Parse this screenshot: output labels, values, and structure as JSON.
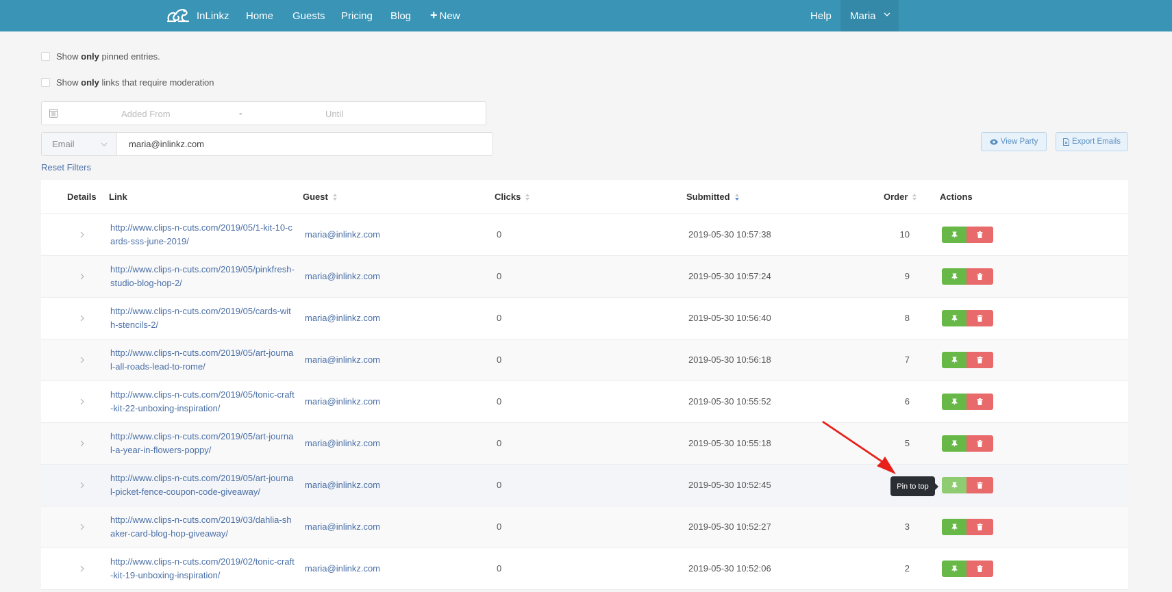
{
  "navbar": {
    "brand": "InLinkz",
    "items": [
      {
        "label": "Home"
      },
      {
        "label": "Guests"
      },
      {
        "label": "Pricing"
      },
      {
        "label": "Blog"
      },
      {
        "label": "New",
        "icon": "plus-icon"
      }
    ],
    "help": "Help",
    "user": "Maria",
    "colors": {
      "bar": "#3994b5",
      "user_active": "#3589a8"
    }
  },
  "filters": {
    "pinned_only": {
      "prefix": "Show ",
      "bold": "only",
      "suffix": " pinned entries.",
      "checked": false
    },
    "moderation_only": {
      "prefix": "Show ",
      "bold": "only",
      "suffix": " links that require moderation",
      "checked": false
    },
    "date_range": {
      "from_placeholder": "Added From",
      "separator": "-",
      "until_placeholder": "Until",
      "icon": "calendar-icon"
    },
    "search_field": {
      "selected": "Email",
      "value": "maria@inlinkz.com"
    },
    "reset_label": "Reset Filters"
  },
  "toolbar": {
    "view_party": "View Party",
    "export_emails": "Export Emails"
  },
  "table": {
    "columns": {
      "details": "Details",
      "link": "Link",
      "guest": "Guest",
      "clicks": "Clicks",
      "submitted": "Submitted",
      "order": "Order",
      "actions": "Actions"
    },
    "sort": {
      "column": "Submitted",
      "direction": "descending"
    },
    "rows": [
      {
        "link": "http://www.clips-n-cuts.com/2019/05/1-kit-10-cards-sss-june-2019/",
        "guest": "maria@inlinkz.com",
        "clicks": "0",
        "submitted": "2019-05-30 10:57:38",
        "order": "10"
      },
      {
        "link": "http://www.clips-n-cuts.com/2019/05/pinkfresh-studio-blog-hop-2/",
        "guest": "maria@inlinkz.com",
        "clicks": "0",
        "submitted": "2019-05-30 10:57:24",
        "order": "9"
      },
      {
        "link": "http://www.clips-n-cuts.com/2019/05/cards-with-stencils-2/",
        "guest": "maria@inlinkz.com",
        "clicks": "0",
        "submitted": "2019-05-30 10:56:40",
        "order": "8"
      },
      {
        "link": "http://www.clips-n-cuts.com/2019/05/art-journal-all-roads-lead-to-rome/",
        "guest": "maria@inlinkz.com",
        "clicks": "0",
        "submitted": "2019-05-30 10:56:18",
        "order": "7"
      },
      {
        "link": "http://www.clips-n-cuts.com/2019/05/tonic-craft-kit-22-unboxing-inspiration/",
        "guest": "maria@inlinkz.com",
        "clicks": "0",
        "submitted": "2019-05-30 10:55:52",
        "order": "6"
      },
      {
        "link": "http://www.clips-n-cuts.com/2019/05/art-journal-a-year-in-flowers-poppy/",
        "guest": "maria@inlinkz.com",
        "clicks": "0",
        "submitted": "2019-05-30 10:55:18",
        "order": "5"
      },
      {
        "link": "http://www.clips-n-cuts.com/2019/05/art-journal-picket-fence-coupon-code-giveaway/",
        "guest": "maria@inlinkz.com",
        "clicks": "0",
        "submitted": "2019-05-30 10:52:45",
        "order": ""
      },
      {
        "link": "http://www.clips-n-cuts.com/2019/03/dahlia-shaker-card-blog-hop-giveaway/",
        "guest": "maria@inlinkz.com",
        "clicks": "0",
        "submitted": "2019-05-30 10:52:27",
        "order": "3"
      },
      {
        "link": "http://www.clips-n-cuts.com/2019/02/tonic-craft-kit-19-unboxing-inspiration/",
        "guest": "maria@inlinkz.com",
        "clicks": "0",
        "submitted": "2019-05-30 10:52:06",
        "order": "2"
      }
    ],
    "action_colors": {
      "pin": "#67b846",
      "delete": "#e86a6a"
    }
  },
  "tooltip": {
    "text": "Pin to top"
  },
  "annotation": {
    "type": "arrow",
    "color": "#e8201a"
  }
}
